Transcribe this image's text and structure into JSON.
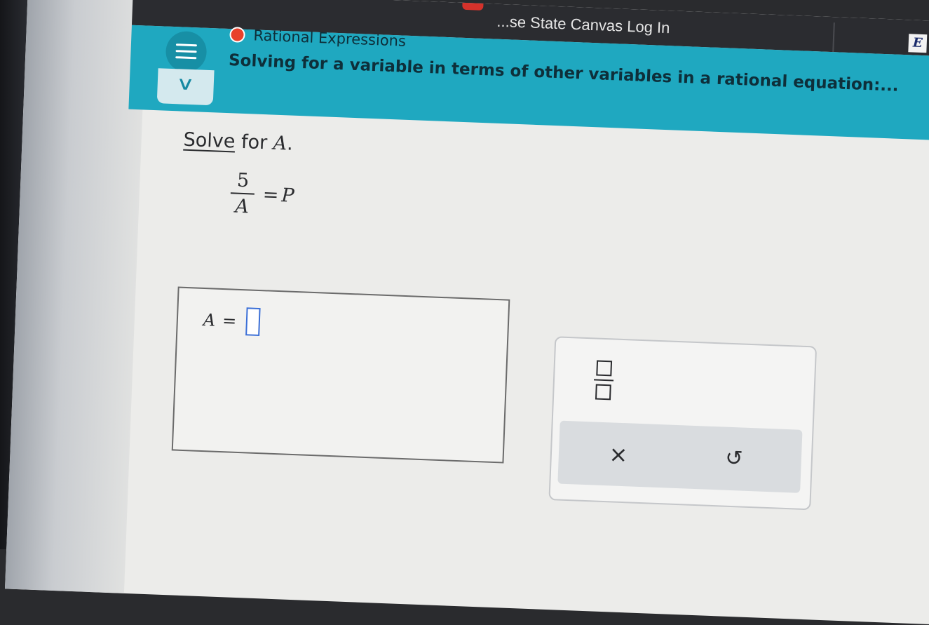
{
  "browser": {
    "tab_title": "...se State Canvas Log In",
    "corner_badge": "E"
  },
  "header": {
    "topic": "Rational Expressions",
    "title": "Solving for a variable in terms of other variables in a rational equation:..."
  },
  "problem": {
    "prompt_link": "Solve",
    "prompt_text": " for ",
    "prompt_var": "A",
    "prompt_end": ".",
    "equation": {
      "numerator": "5",
      "denominator": "A",
      "equals": "=",
      "rhs": "P"
    }
  },
  "answer": {
    "lhs_var": "A",
    "equals": "="
  },
  "keypad": {
    "fraction_key": "fraction-template",
    "clear_label": "×",
    "undo_label": "↺"
  },
  "colors": {
    "header_teal": "#1fa8c0",
    "status_dot": "#e8412c",
    "cursor_blue": "#3b6fd6"
  }
}
